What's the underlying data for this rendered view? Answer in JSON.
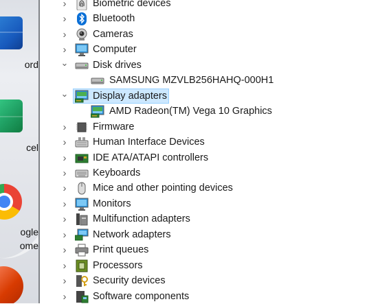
{
  "desktop": {
    "word_label": "ord",
    "excel_label": "cel",
    "chrome_label_1": "ogle",
    "chrome_label_2": "ome"
  },
  "tree": {
    "categories": [
      {
        "label": "Biometric devices",
        "icon": "fingerprint-icon",
        "expanded": false
      },
      {
        "label": "Bluetooth",
        "icon": "bluetooth-icon",
        "expanded": false
      },
      {
        "label": "Cameras",
        "icon": "camera-icon",
        "expanded": false
      },
      {
        "label": "Computer",
        "icon": "monitor-icon",
        "expanded": false
      },
      {
        "label": "Disk drives",
        "icon": "disk-drive-icon",
        "expanded": true,
        "children": [
          {
            "label": "SAMSUNG MZVLB256HAHQ-000H1",
            "icon": "disk-drive-icon"
          }
        ]
      },
      {
        "label": "Display adapters",
        "icon": "display-adapter-icon",
        "expanded": true,
        "selected": true,
        "children": [
          {
            "label": "AMD Radeon(TM) Vega 10 Graphics",
            "icon": "display-adapter-icon"
          }
        ]
      },
      {
        "label": "Firmware",
        "icon": "chip-icon",
        "expanded": false
      },
      {
        "label": "Human Interface Devices",
        "icon": "hid-icon",
        "expanded": false
      },
      {
        "label": "IDE ATA/ATAPI controllers",
        "icon": "ide-controller-icon",
        "expanded": false
      },
      {
        "label": "Keyboards",
        "icon": "keyboard-icon",
        "expanded": false
      },
      {
        "label": "Mice and other pointing devices",
        "icon": "mouse-icon",
        "expanded": false
      },
      {
        "label": "Monitors",
        "icon": "monitor-icon",
        "expanded": false
      },
      {
        "label": "Multifunction adapters",
        "icon": "multifunction-icon",
        "expanded": false
      },
      {
        "label": "Network adapters",
        "icon": "network-icon",
        "expanded": false
      },
      {
        "label": "Print queues",
        "icon": "printer-icon",
        "expanded": false
      },
      {
        "label": "Processors",
        "icon": "processor-icon",
        "expanded": false
      },
      {
        "label": "Security devices",
        "icon": "security-key-icon",
        "expanded": false
      },
      {
        "label": "Software components",
        "icon": "software-component-icon",
        "expanded": false
      }
    ]
  },
  "colors": {
    "selection_bg": "#cce8ff",
    "selection_border": "#99d1ff",
    "text": "#1a1a1a",
    "chevron": "#606060"
  }
}
